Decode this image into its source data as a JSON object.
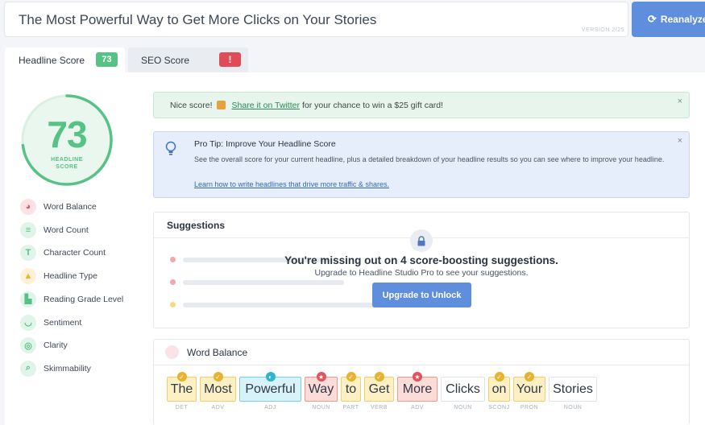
{
  "headline": {
    "text": "The Most Powerful Way to Get More Clicks on Your Stories",
    "version": "VERSION 2/25"
  },
  "reanalyze_label": "Reanalyze",
  "tabs": [
    {
      "label": "Headline Score",
      "badge": "73",
      "active": true
    },
    {
      "label": "SEO Score",
      "badge": "!",
      "active": false
    }
  ],
  "score": {
    "value": "73",
    "label_line1": "HEADLINE",
    "label_line2": "SCORE",
    "fill": 0.73,
    "color": "#56c285"
  },
  "metrics": [
    {
      "label": "Word Balance",
      "icon": "pie-chart-icon",
      "color": "#e0525d",
      "bg": "#fbe3e5"
    },
    {
      "label": "Word Count",
      "icon": "lines-icon",
      "color": "#56c285",
      "bg": "#e1f4e9"
    },
    {
      "label": "Character Count",
      "icon": "text-t-icon",
      "color": "#56c285",
      "bg": "#e1f4e9"
    },
    {
      "label": "Headline Type",
      "icon": "shapes-icon",
      "color": "#f0b429",
      "bg": "#fdf2d6"
    },
    {
      "label": "Reading Grade Level",
      "icon": "book-icon",
      "color": "#56c285",
      "bg": "#e1f4e9"
    },
    {
      "label": "Sentiment",
      "icon": "smile-icon",
      "color": "#56c285",
      "bg": "#e1f4e9"
    },
    {
      "label": "Clarity",
      "icon": "target-icon",
      "color": "#56c285",
      "bg": "#e1f4e9"
    },
    {
      "label": "Skimmability",
      "icon": "magnifier-icon",
      "color": "#56c285",
      "bg": "#e1f4e9"
    }
  ],
  "share_alert": {
    "prefix": "Nice score!",
    "link": "Share it on Twitter",
    "suffix": "for your chance to win a $25 gift card!",
    "close": "×"
  },
  "pro_tip": {
    "title": "Pro Tip: Improve Your Headline Score",
    "description": "See the overall score for your current headline, plus a detailed breakdown of your headline results so you can see where to improve your headline.",
    "link": "Learn how to write headlines that drive more traffic & shares.",
    "close": "×"
  },
  "suggestions": {
    "heading": "Suggestions",
    "missing": "You're missing out on 4 score-boosting suggestions.",
    "upgrade_text": "Upgrade to Headline Studio Pro to see your suggestions.",
    "unlock_label": "Upgrade to Unlock"
  },
  "word_balance": {
    "heading": "Word Balance",
    "words": [
      {
        "text": "The",
        "pos": "DET",
        "style": "yellow",
        "badge": "✓"
      },
      {
        "text": "Most",
        "pos": "ADV",
        "style": "yellow",
        "badge": "✓"
      },
      {
        "text": "Powerful",
        "pos": "ADJ",
        "style": "blue",
        "badge": "◐"
      },
      {
        "text": "Way",
        "pos": "NOUN",
        "style": "red",
        "badge": "★"
      },
      {
        "text": "to",
        "pos": "PART",
        "style": "yellow",
        "badge": "✓"
      },
      {
        "text": "Get",
        "pos": "VERB",
        "style": "yellow",
        "badge": "✓"
      },
      {
        "text": "More",
        "pos": "ADV",
        "style": "red",
        "badge": "★"
      },
      {
        "text": "Clicks",
        "pos": "NOUN",
        "style": "white",
        "badge": ""
      },
      {
        "text": "on",
        "pos": "SCONJ",
        "style": "yellow",
        "badge": "✓"
      },
      {
        "text": "Your",
        "pos": "PRON",
        "style": "yellow",
        "badge": "✓"
      },
      {
        "text": "Stories",
        "pos": "NOUN",
        "style": "white",
        "badge": ""
      }
    ]
  },
  "colors": {
    "accent": "#5f8edc",
    "green": "#56c285",
    "red": "#df4b57",
    "yellow": "#f0b429",
    "blue": "#2fb4d0"
  }
}
